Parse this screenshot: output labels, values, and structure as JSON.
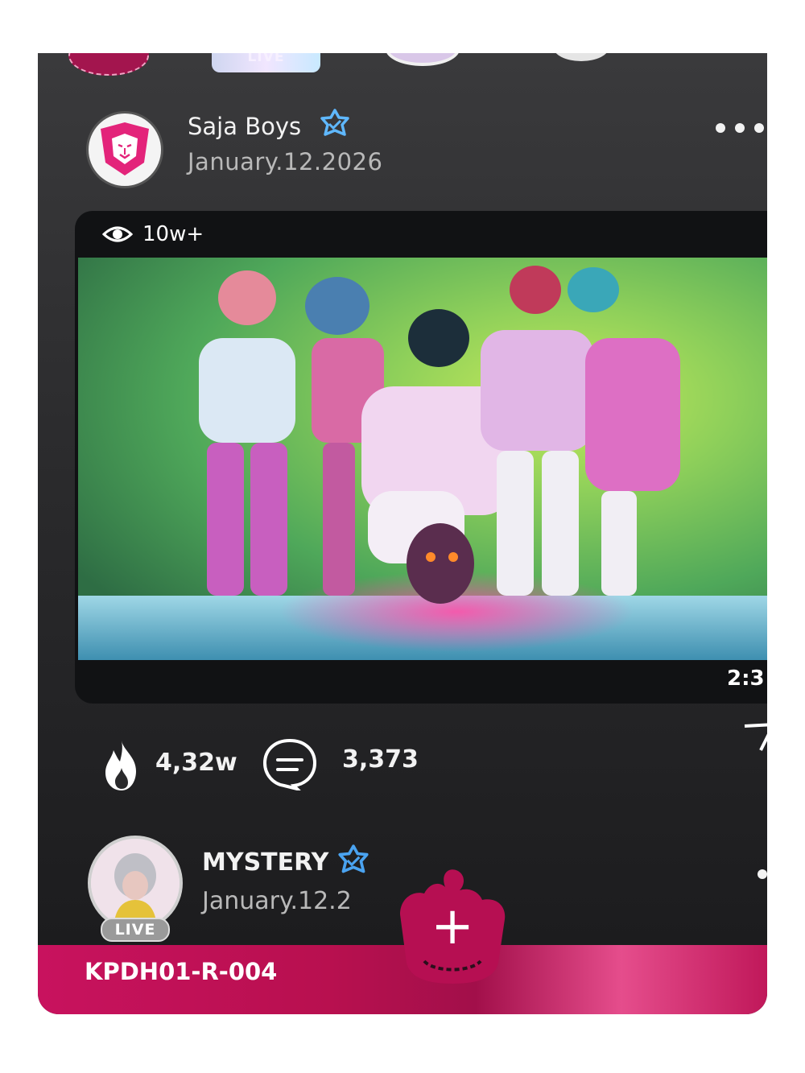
{
  "stories": {
    "live_label": "LIVE"
  },
  "post": {
    "author": "Saja Boys",
    "date": "January.12.2026",
    "views": "10w+",
    "duration": "2:3",
    "likes": "4,32w",
    "comments": "3,373"
  },
  "next_post": {
    "author": "MYSTERY",
    "date": "January.12.2",
    "live_label": "LIVE"
  },
  "footer": {
    "card_code": "KPDH01-R-004",
    "add_symbol": "+"
  },
  "colors": {
    "accent_pink": "#c8125e",
    "verified_blue": "#5fb8ff",
    "card_bg": "#2a2a2c"
  },
  "icons": [
    "lion-logo-icon",
    "verified-badge-icon",
    "more-options-icon",
    "eye-icon",
    "flame-icon",
    "comment-icon",
    "share-icon",
    "add-icon"
  ]
}
